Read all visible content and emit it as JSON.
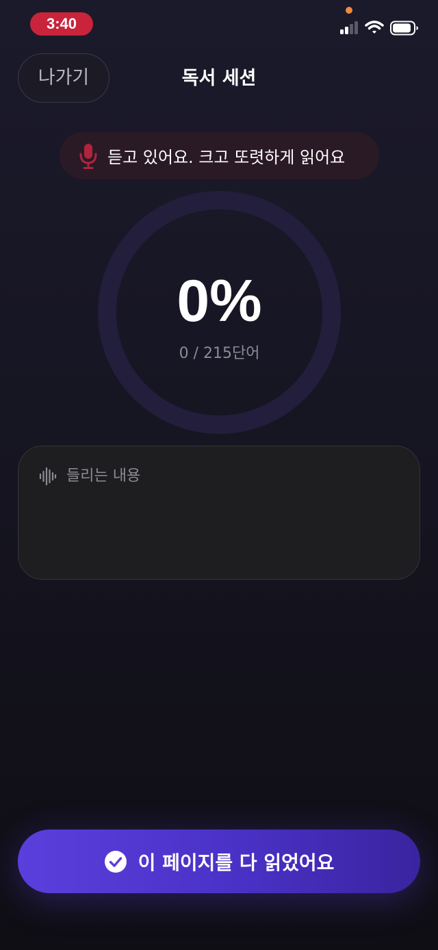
{
  "status_bar": {
    "time": "3:40",
    "time_pill_color": "#c9243b",
    "privacy_dot_color": "#f08a3c",
    "icons": [
      "cellular-signal-icon",
      "wifi-icon",
      "battery-icon"
    ]
  },
  "header": {
    "exit_label": "나가기",
    "title": "독서 세션"
  },
  "listening_banner": {
    "icon": "microphone-icon",
    "icon_color": "#b0243e",
    "text": "듣고 있어요. 크고 또렷하게 읽어요"
  },
  "progress": {
    "percent_text": "0%",
    "fraction": 0,
    "word_count_text": "0 / 215단어",
    "words_read": 0,
    "words_total": 215,
    "ring_color": "#221e3c"
  },
  "transcript": {
    "icon": "waveform-icon",
    "label": "들리는 내용",
    "text": ""
  },
  "footer": {
    "done_icon": "check-circle-icon",
    "done_label": "이 페이지를 다 읽었어요",
    "accent_color": "#5b3fdc"
  }
}
